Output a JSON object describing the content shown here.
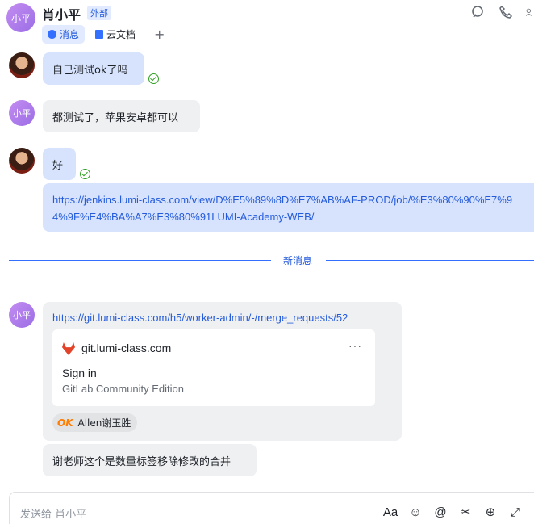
{
  "header": {
    "avatar_text": "小平",
    "name": "肖小平",
    "badge": "外部",
    "tabs": [
      {
        "label": "消息",
        "icon": "chat-bubble-icon",
        "active": true
      },
      {
        "label": "云文档",
        "icon": "doc-icon",
        "active": false
      }
    ],
    "add_tab_label": "+"
  },
  "messages": [
    {
      "sender": "self",
      "text": "自己测试ok了吗",
      "read": true
    },
    {
      "sender": "肖小平",
      "avatar_text": "小平",
      "text": "都测试了，苹果安卓都可以"
    },
    {
      "sender": "self",
      "text": "好",
      "read": true
    },
    {
      "sender": "self",
      "text": "https://jenkins.lumi-class.com/view/D%E5%89%8D%E7%AB%AF-PROD/job/%E3%80%90%E7%94%9F%E4%BA%A7%E3%80%91LUMI-Academy-WEB/"
    }
  ],
  "divider_label": "新消息",
  "card_message": {
    "avatar_text": "小平",
    "link": "https://git.lumi-class.com/h5/worker-admin/-/merge_requests/52",
    "preview": {
      "host": "git.lumi-class.com",
      "more": "···",
      "title": "Sign in",
      "description": "GitLab Community Edition"
    },
    "reaction": {
      "emoji": "OK",
      "user": "Allen谢玉胜"
    }
  },
  "last_message": "谢老师这个是数量标签移除修改的合并",
  "composer": {
    "placeholder": "发送给 肖小平",
    "tools": [
      {
        "name": "format-icon",
        "glyph": "Aa"
      },
      {
        "name": "emoji-icon",
        "glyph": "☺"
      },
      {
        "name": "mention-icon",
        "glyph": "@"
      },
      {
        "name": "screenshot-scissors-icon",
        "glyph": "✂"
      },
      {
        "name": "add-icon",
        "glyph": "⊕"
      },
      {
        "name": "expand-icon",
        "glyph": "⤢"
      }
    ]
  },
  "colors": {
    "accent": "#245bdb",
    "self_bubble": "#d7e3fd",
    "other_bubble": "#eff0f1",
    "read_check": "#2ea121"
  }
}
